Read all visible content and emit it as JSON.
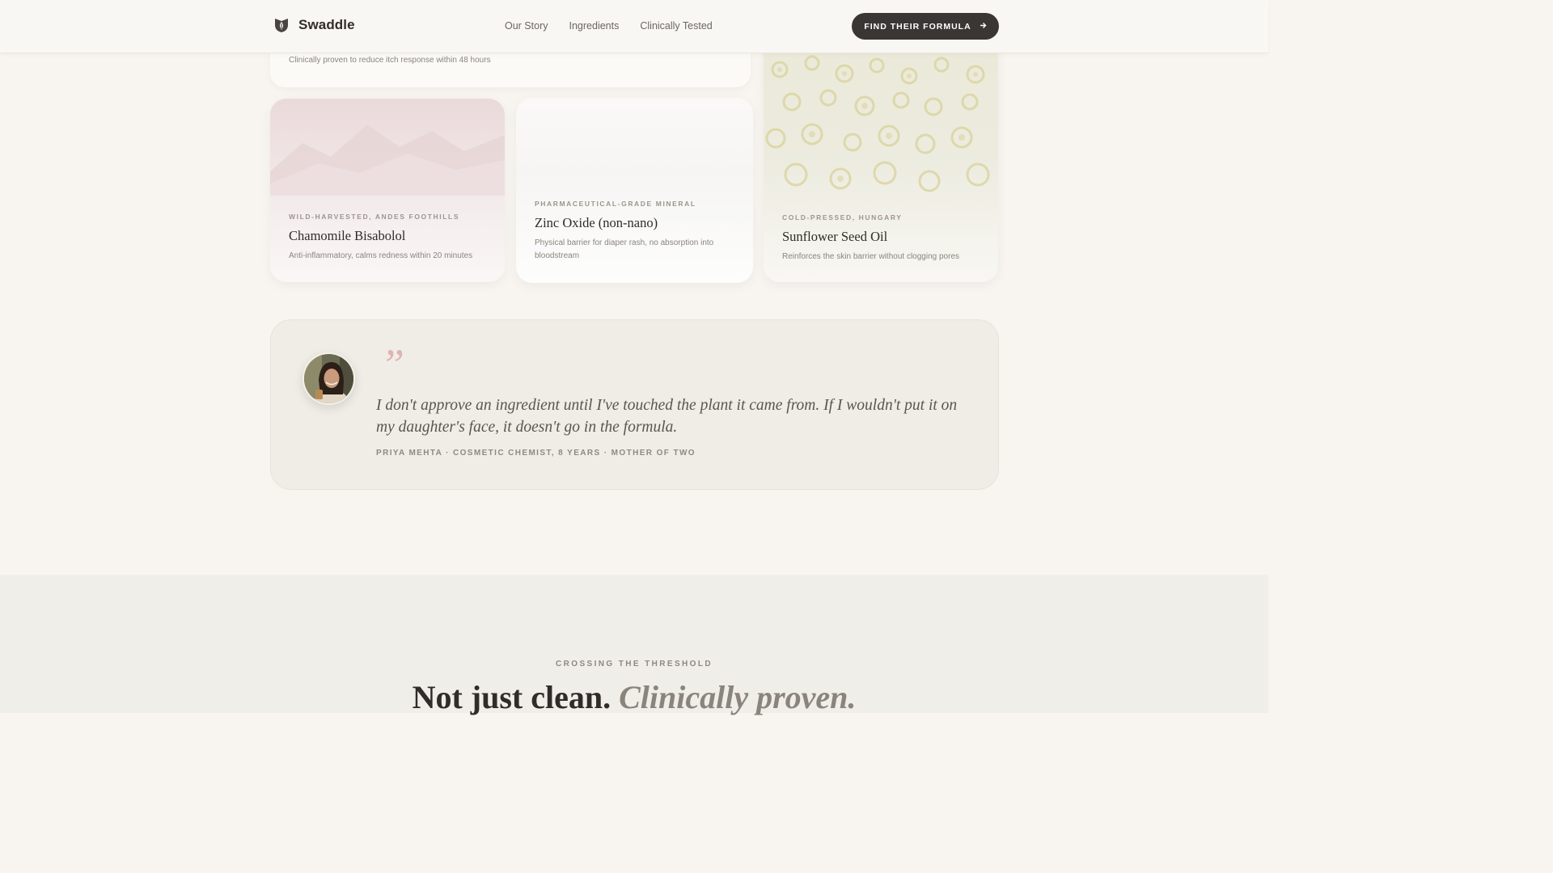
{
  "nav": {
    "brand": "Swaddle",
    "brand_icon": "leaf-shield-icon",
    "links": [
      "Our Story",
      "Ingredients",
      "Clinically Tested"
    ],
    "cta_label": "FIND THEIR FORMULA",
    "cta_icon": "arrow-right-icon",
    "cta_color": "#3a3633"
  },
  "top_card": {
    "description": "Clinically proven to reduce itch response within 48 hours"
  },
  "ingredients": [
    {
      "origin": "WILD-HARVESTED, ANDES FOOTHILLS",
      "name": "Chamomile Bisabolol",
      "description": "Anti-inflammatory, calms redness within 20 minutes"
    },
    {
      "origin": "PHARMACEUTICAL-GRADE MINERAL",
      "name": "Zinc Oxide (non-nano)",
      "description": "Physical barrier for diaper rash, no absorption into bloodstream"
    },
    {
      "origin": "COLD-PRESSED, HUNGARY",
      "name": "Sunflower Seed Oil",
      "description": "Reinforces the skin barrier without clogging pores"
    }
  ],
  "testimonial": {
    "quote_mark": "”",
    "quote": "I don't approve an ingredient until I've touched the plant it came from. If I wouldn't put it on my daughter's face, it doesn't go in the formula.",
    "author": "PRIYA MEHTA · COSMETIC CHEMIST, 8 YEARS · MOTHER OF TWO",
    "accent_color": "#e0b3b1"
  },
  "threshold": {
    "eyebrow": "CROSSING THE THRESHOLD",
    "headline_main": "Not just clean.",
    "headline_accent": "Clinically proven."
  }
}
